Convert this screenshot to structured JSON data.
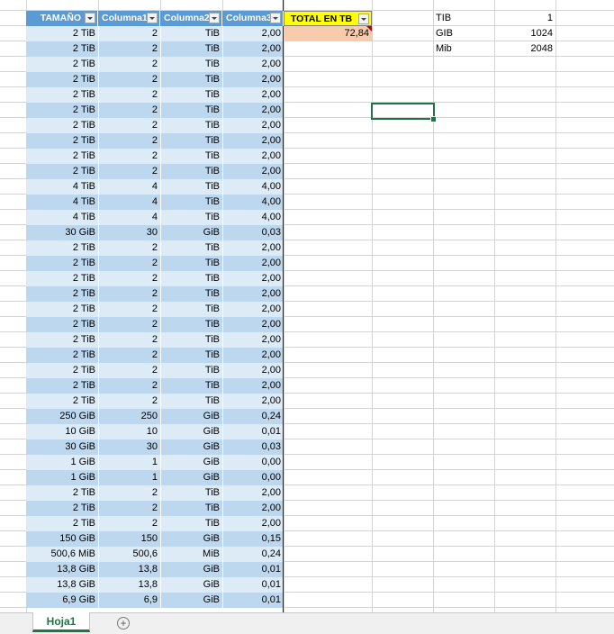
{
  "sheet": {
    "headers": [
      {
        "label": "TAMAÑO"
      },
      {
        "label": "Columna1"
      },
      {
        "label": "Columna2"
      },
      {
        "label": "Columna3"
      },
      {
        "label": "TOTAL EN TB"
      }
    ],
    "total_value": "72,84",
    "rows": [
      [
        "2 TiB",
        "2",
        "TiB",
        "2,00"
      ],
      [
        "2 TiB",
        "2",
        "TiB",
        "2,00"
      ],
      [
        "2 TiB",
        "2",
        "TiB",
        "2,00"
      ],
      [
        "2 TiB",
        "2",
        "TiB",
        "2,00"
      ],
      [
        "2 TiB",
        "2",
        "TiB",
        "2,00"
      ],
      [
        "2 TiB",
        "2",
        "TiB",
        "2,00"
      ],
      [
        "2 TiB",
        "2",
        "TiB",
        "2,00"
      ],
      [
        "2 TiB",
        "2",
        "TiB",
        "2,00"
      ],
      [
        "2 TiB",
        "2",
        "TiB",
        "2,00"
      ],
      [
        "2 TiB",
        "2",
        "TiB",
        "2,00"
      ],
      [
        "4 TiB",
        "4",
        "TiB",
        "4,00"
      ],
      [
        "4 TiB",
        "4",
        "TiB",
        "4,00"
      ],
      [
        "4 TiB",
        "4",
        "TiB",
        "4,00"
      ],
      [
        "30 GiB",
        "30",
        "GiB",
        "0,03"
      ],
      [
        "2 TiB",
        "2",
        "TiB",
        "2,00"
      ],
      [
        "2 TiB",
        "2",
        "TiB",
        "2,00"
      ],
      [
        "2 TiB",
        "2",
        "TiB",
        "2,00"
      ],
      [
        "2 TiB",
        "2",
        "TiB",
        "2,00"
      ],
      [
        "2 TiB",
        "2",
        "TiB",
        "2,00"
      ],
      [
        "2 TiB",
        "2",
        "TiB",
        "2,00"
      ],
      [
        "2 TiB",
        "2",
        "TiB",
        "2,00"
      ],
      [
        "2 TiB",
        "2",
        "TiB",
        "2,00"
      ],
      [
        "2 TiB",
        "2",
        "TiB",
        "2,00"
      ],
      [
        "2 TiB",
        "2",
        "TiB",
        "2,00"
      ],
      [
        "2 TiB",
        "2",
        "TiB",
        "2,00"
      ],
      [
        "250 GiB",
        "250",
        "GiB",
        "0,24"
      ],
      [
        "10 GiB",
        "10",
        "GiB",
        "0,01"
      ],
      [
        "30 GiB",
        "30",
        "GiB",
        "0,03"
      ],
      [
        "1 GiB",
        "1",
        "GiB",
        "0,00"
      ],
      [
        "1 GiB",
        "1",
        "GiB",
        "0,00"
      ],
      [
        "2 TiB",
        "2",
        "TiB",
        "2,00"
      ],
      [
        "2 TiB",
        "2",
        "TiB",
        "2,00"
      ],
      [
        "2 TiB",
        "2",
        "TiB",
        "2,00"
      ],
      [
        "150 GiB",
        "150",
        "GiB",
        "0,15"
      ],
      [
        "500,6 MiB",
        "500,6",
        "MiB",
        "0,24"
      ],
      [
        "13,8 GiB",
        "13,8",
        "GiB",
        "0,01"
      ],
      [
        "13,8 GiB",
        "13,8",
        "GiB",
        "0,01"
      ],
      [
        "6,9 GiB",
        "6,9",
        "GiB",
        "0,01"
      ]
    ],
    "lookup": [
      {
        "unit": "TIB",
        "value": "1"
      },
      {
        "unit": "GIB",
        "value": "1024"
      },
      {
        "unit": "Mib",
        "value": "2048"
      }
    ]
  },
  "tabs": {
    "active_sheet": "Hoja1",
    "add_sheet_symbol": "+"
  },
  "colors": {
    "header_blue": "#5b9bd5",
    "band_dark": "#bdd7ee",
    "band_light": "#ddebf7",
    "total_header": "#ffff00",
    "total_cell": "#f8cbad",
    "selection": "#217346"
  }
}
